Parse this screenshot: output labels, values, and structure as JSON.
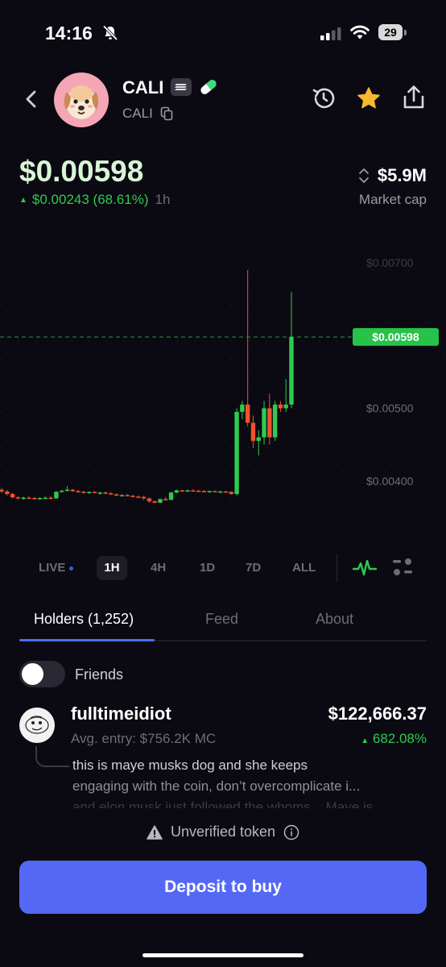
{
  "status_bar": {
    "time": "14:16",
    "battery": "29"
  },
  "token": {
    "name": "CALI",
    "ticker": "CALI"
  },
  "price": {
    "current": "$0.00598",
    "change": "$0.00243 (68.61%)",
    "period": "1h",
    "market_cap": "$5.9M",
    "market_cap_label": "Market cap"
  },
  "chart": {
    "y_ticks": [
      "$0.00700",
      "$0.00500",
      "$0.00400"
    ],
    "current_label": "$0.00598",
    "colors": {
      "up": "#2ecb4f",
      "down": "#f0522e",
      "current_tag": "#27c24a"
    }
  },
  "chart_data": {
    "type": "candlestick",
    "ylim": [
      0.0033,
      0.0074
    ],
    "current_price": 0.00598,
    "ticks": [
      0.007,
      0.005,
      0.004
    ],
    "candles": [
      [
        0.00388,
        0.0039,
        0.00383,
        0.003855
      ],
      [
        0.003855,
        0.003875,
        0.0038,
        0.00382
      ],
      [
        0.00382,
        0.00384,
        0.00376,
        0.003775
      ],
      [
        0.003775,
        0.00379,
        0.00375,
        0.003765
      ],
      [
        0.003765,
        0.003785,
        0.00374,
        0.00377
      ],
      [
        0.00377,
        0.00379,
        0.00375,
        0.003765
      ],
      [
        0.003765,
        0.00378,
        0.003745,
        0.00376
      ],
      [
        0.00376,
        0.003775,
        0.00374,
        0.003765
      ],
      [
        0.003765,
        0.00379,
        0.003755,
        0.00377
      ],
      [
        0.00377,
        0.00379,
        0.003745,
        0.00376
      ],
      [
        0.00376,
        0.00386,
        0.003755,
        0.00385
      ],
      [
        0.00385,
        0.00388,
        0.00384,
        0.003865
      ],
      [
        0.003865,
        0.00393,
        0.003855,
        0.00388
      ],
      [
        0.00388,
        0.00389,
        0.00385,
        0.00386
      ],
      [
        0.00386,
        0.003875,
        0.00384,
        0.00385
      ],
      [
        0.00385,
        0.003865,
        0.00383,
        0.00384
      ],
      [
        0.00384,
        0.003855,
        0.00382,
        0.00385
      ],
      [
        0.00385,
        0.00386,
        0.00383,
        0.003835
      ],
      [
        0.003835,
        0.00385,
        0.00381,
        0.00384
      ],
      [
        0.00384,
        0.003855,
        0.00382,
        0.00383
      ],
      [
        0.00383,
        0.003845,
        0.003805,
        0.003815
      ],
      [
        0.003815,
        0.00383,
        0.00379,
        0.0038
      ],
      [
        0.0038,
        0.003815,
        0.003785,
        0.003805
      ],
      [
        0.003805,
        0.00382,
        0.00379,
        0.003795
      ],
      [
        0.003795,
        0.00381,
        0.003775,
        0.003785
      ],
      [
        0.003785,
        0.0038,
        0.00377,
        0.00378
      ],
      [
        0.00378,
        0.003795,
        0.00374,
        0.00376
      ],
      [
        0.00376,
        0.00377,
        0.0037,
        0.00372
      ],
      [
        0.00372,
        0.00373,
        0.00369,
        0.0037
      ],
      [
        0.0037,
        0.00376,
        0.003695,
        0.00375
      ],
      [
        0.00375,
        0.00378,
        0.00373,
        0.00374
      ],
      [
        0.00374,
        0.00385,
        0.003735,
        0.00384
      ],
      [
        0.00384,
        0.00388,
        0.003835,
        0.00387
      ],
      [
        0.00387,
        0.00388,
        0.00385,
        0.00386
      ],
      [
        0.00386,
        0.00388,
        0.00385,
        0.00387
      ],
      [
        0.00387,
        0.003885,
        0.003855,
        0.003865
      ],
      [
        0.003865,
        0.00388,
        0.00385,
        0.00386
      ],
      [
        0.00386,
        0.003875,
        0.003845,
        0.003855
      ],
      [
        0.003855,
        0.00387,
        0.00384,
        0.00386
      ],
      [
        0.00386,
        0.00387,
        0.003845,
        0.00385
      ],
      [
        0.00385,
        0.003865,
        0.00384,
        0.003855
      ],
      [
        0.003855,
        0.003865,
        0.00384,
        0.00385
      ],
      [
        0.00385,
        0.00386,
        0.00381,
        0.00382
      ],
      [
        0.00382,
        0.005,
        0.0038,
        0.00495
      ],
      [
        0.00495,
        0.0051,
        0.00485,
        0.00505
      ],
      [
        0.00505,
        0.0069,
        0.00475,
        0.0048
      ],
      [
        0.0048,
        0.0049,
        0.00445,
        0.00455
      ],
      [
        0.00455,
        0.0047,
        0.00435,
        0.0046
      ],
      [
        0.0046,
        0.0051,
        0.0045,
        0.005
      ],
      [
        0.005,
        0.0052,
        0.0045,
        0.0046
      ],
      [
        0.0046,
        0.0051,
        0.00455,
        0.00505
      ],
      [
        0.00505,
        0.0051,
        0.00495,
        0.005
      ],
      [
        0.005,
        0.0054,
        0.00495,
        0.00505
      ],
      [
        0.00505,
        0.0066,
        0.005,
        0.00598
      ]
    ]
  },
  "timeframes": [
    "LIVE",
    "1H",
    "4H",
    "1D",
    "7D",
    "ALL"
  ],
  "tabs": {
    "holders": "Holders (1,252)",
    "feed": "Feed",
    "about": "About"
  },
  "friends": {
    "label": "Friends",
    "enabled": false
  },
  "holder": {
    "name": "fulltimeidiot",
    "value": "$122,666.37",
    "entry": "Avg. entry: $756.2K MC",
    "pct": "682.08%",
    "comment_line1": "this is maye musks dog and she keeps",
    "comment_line2": "engaging with the coin, don’t overcomplicate i...",
    "comment_line3": "and elon musk just followed the whoms... Maye is"
  },
  "warning": {
    "label": "Unverified token"
  },
  "cta": {
    "label": "Deposit to buy"
  }
}
